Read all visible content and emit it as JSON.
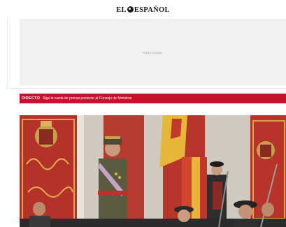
{
  "header": {
    "logo_text_left": "EL",
    "logo_text_right": "ESPAÑOL"
  },
  "ad": {
    "label": "PUBLICIDAD"
  },
  "breaking": {
    "tag": "DIRECTO",
    "headline": "Siga la rueda de prensa posterior al Consejo de Ministros"
  },
  "colors": {
    "brand_red": "#c8102e",
    "ad_background": "#f1f1f1"
  },
  "lead_image": {
    "icon": "news-photo-image"
  }
}
